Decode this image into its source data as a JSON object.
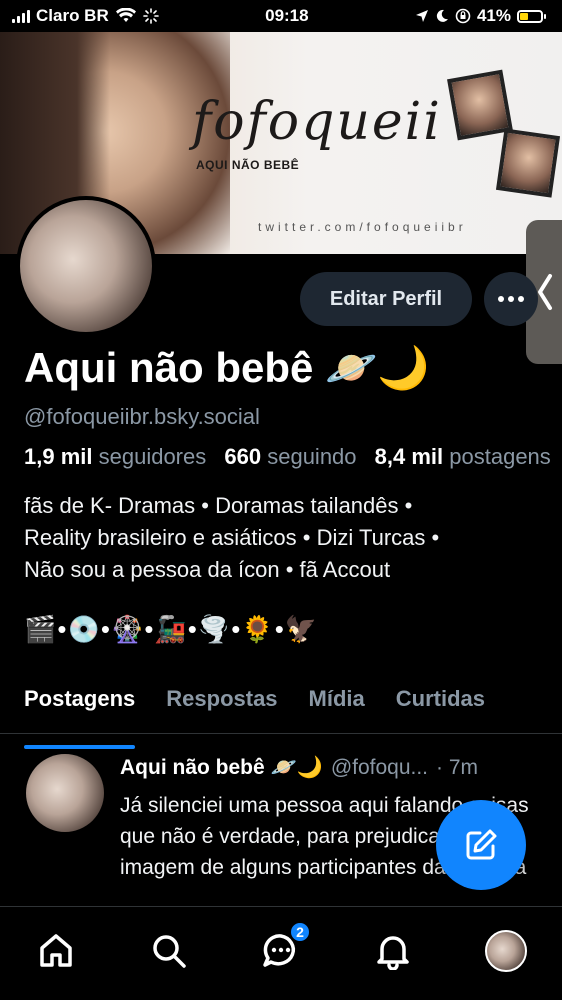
{
  "status_bar": {
    "carrier": "Claro BR",
    "time": "09:18",
    "battery": "41%"
  },
  "banner": {
    "brand_title": "fofoqueii",
    "brand_sub": "AQUI NÃO BEBÊ",
    "url": "twitter.com/fofoqueiibr"
  },
  "profile": {
    "display_name": "Aqui não bebê 🪐🌙",
    "handle": "@fofoqueiibr.bsky.social",
    "followers_count": "1,9 mil",
    "followers_label": "seguidores",
    "following_count": "660",
    "following_label": "seguindo",
    "posts_count": "8,4 mil",
    "posts_label": "postagens",
    "bio_line1": "fãs de K- Dramas • Doramas tailandês •",
    "bio_line2": "Reality brasileiro e asiáticos • Dizi Turcas •",
    "bio_line3": "Não sou a pessoa da ícon • fã Accout",
    "emoji_line": "🎬•💿•🎡•🚂•🌪️•🌻•🦅",
    "edit_button": "Editar Perfil"
  },
  "tabs": [
    {
      "label": "Postagens",
      "active": true
    },
    {
      "label": "Respostas",
      "active": false
    },
    {
      "label": "Mídia",
      "active": false
    },
    {
      "label": "Curtidas",
      "active": false
    }
  ],
  "post": {
    "author": "Aqui não bebê 🪐🌙",
    "handle": "@fofoqu...",
    "time": "· 7m",
    "text": "Já silenciei uma pessoa aqui falando coisas que não é verdade, para prejudicar a imagem de alguns participantes da fazenda"
  },
  "bottom_nav": {
    "chat_badge": "2"
  },
  "colors": {
    "accent": "#1185fe",
    "muted_text": "#8b98a5",
    "button_bg": "#1e2732"
  }
}
